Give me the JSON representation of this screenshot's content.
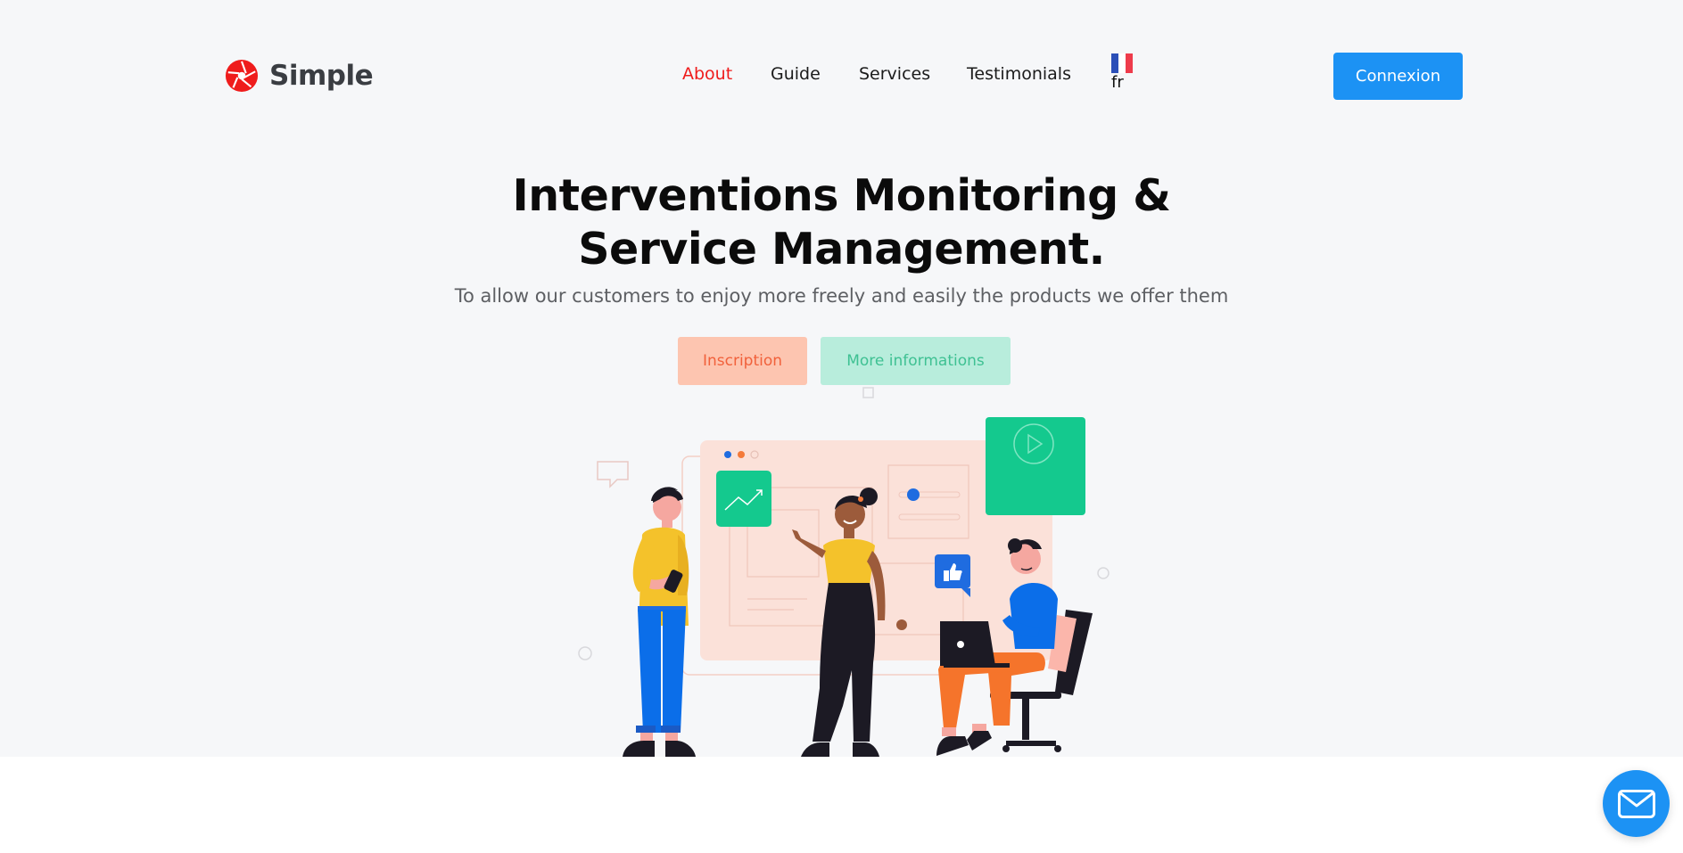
{
  "brand": {
    "name": "Simple",
    "logo_color": "#ef1c1c"
  },
  "nav": {
    "items": [
      {
        "label": "About",
        "active": true
      },
      {
        "label": "Guide",
        "active": false
      },
      {
        "label": "Services",
        "active": false
      },
      {
        "label": "Testimonials",
        "active": false
      }
    ],
    "active_color": "#ef1c1c"
  },
  "language": {
    "code": "fr",
    "flag_icon": "france-flag-icon"
  },
  "header": {
    "login_label": "Connexion",
    "login_color": "#1c92f4"
  },
  "hero": {
    "title_line1": "Interventions Monitoring &",
    "title_line2": "Service Management.",
    "subtitle": "To allow our customers to enjoy more freely and easily the products we offer them",
    "signup_label": "Inscription",
    "more_label": "More informations",
    "illustration_icon": "team-collaboration-illustration"
  },
  "floating": {
    "mail_icon": "mail-icon",
    "mail_color": "#1c92f4"
  }
}
